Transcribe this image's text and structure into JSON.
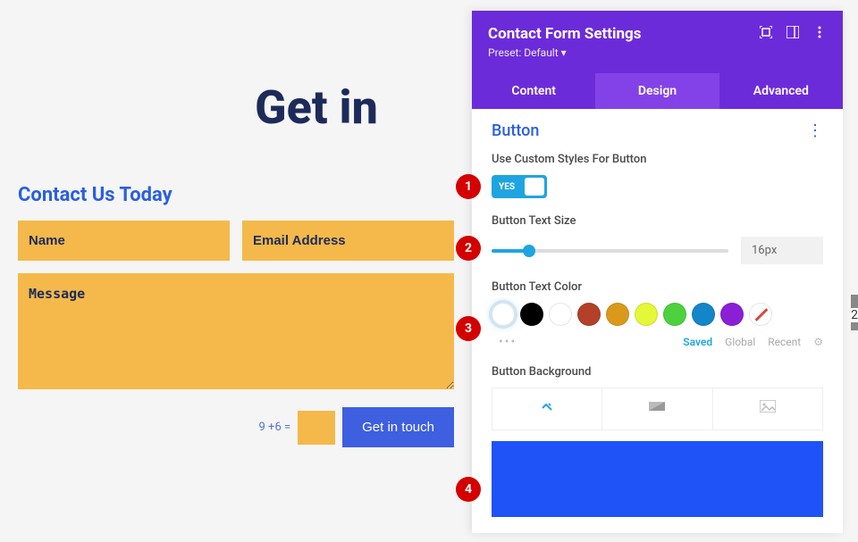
{
  "page": {
    "title": "Get in"
  },
  "form": {
    "heading": "Contact Us Today",
    "name_placeholder": "Name",
    "email_placeholder": "Email Address",
    "message_placeholder": "Message",
    "captcha": "9 +6 =",
    "submit_label": "Get in touch"
  },
  "panel": {
    "title": "Contact Form Settings",
    "preset": "Preset: Default ▾",
    "tabs": [
      "Content",
      "Design",
      "Advanced"
    ],
    "active_tab": 1,
    "section_title": "Button",
    "fields": {
      "custom_styles_label": "Use Custom Styles For Button",
      "custom_styles_value": "YES",
      "text_size_label": "Button Text Size",
      "text_size_value": "16px",
      "text_color_label": "Button Text Color",
      "background_label": "Button Background"
    },
    "swatch_tabs": [
      "Saved",
      "Global",
      "Recent"
    ],
    "swatch_tabs_active": 0,
    "colors": [
      "#ffffff",
      "#000000",
      "#ffffff",
      "#b3412a",
      "#d99a1c",
      "#e4f738",
      "#4dd13f",
      "#1385c9",
      "#8a1fd6",
      "none"
    ],
    "bg_color": "#1f52f7"
  },
  "callouts": [
    "1",
    "2",
    "3",
    "4"
  ],
  "edge_num": "2"
}
